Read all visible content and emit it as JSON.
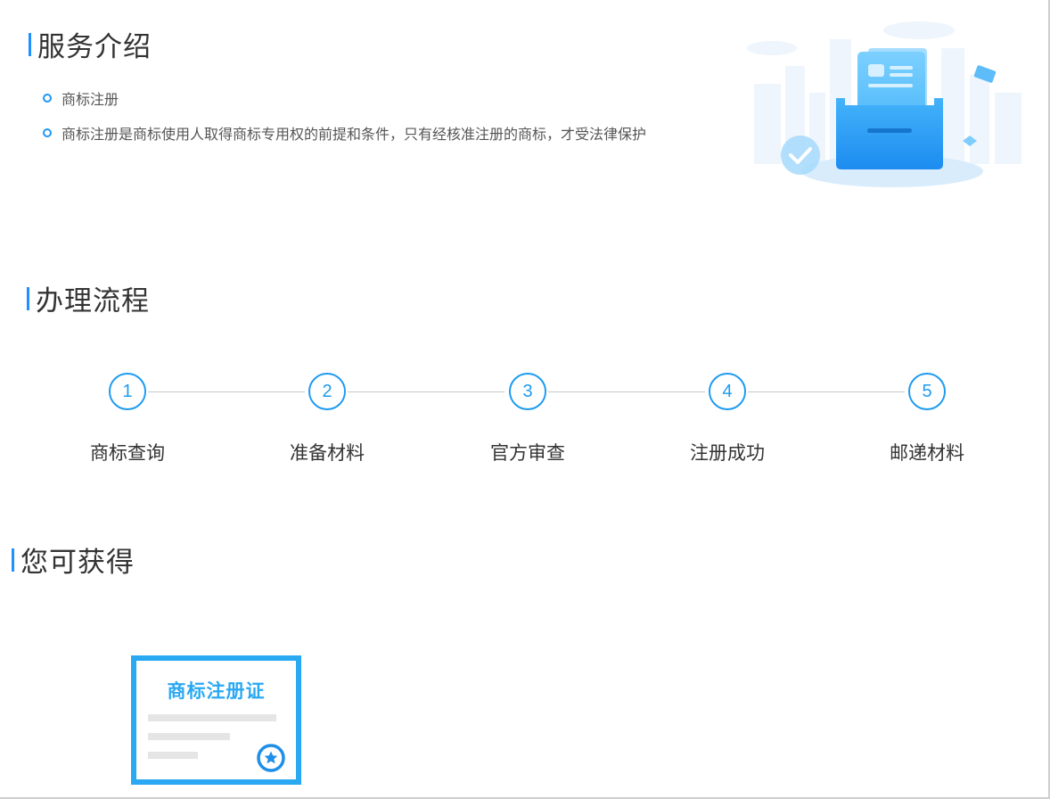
{
  "sections": {
    "service_intro": "服务介绍",
    "process": "办理流程",
    "benefits": "您可获得"
  },
  "intro_items": [
    "商标注册",
    "商标注册是商标使用人取得商标专用权的前提和条件，只有经核准注册的商标，才受法律保护"
  ],
  "steps": [
    {
      "number": "1",
      "label": "商标查询"
    },
    {
      "number": "2",
      "label": "准备材料"
    },
    {
      "number": "3",
      "label": "官方审查"
    },
    {
      "number": "4",
      "label": "注册成功"
    },
    {
      "number": "5",
      "label": "邮递材料"
    }
  ],
  "certificate": {
    "title": "商标注册证"
  },
  "colors": {
    "accent": "#1e90ff",
    "step_blue": "#1e9bf0",
    "cert_blue": "#2aa8f2"
  },
  "icons": {
    "illustration": "document-folder-illustration",
    "check": "check-circle-icon",
    "badge": "star-badge-icon"
  }
}
